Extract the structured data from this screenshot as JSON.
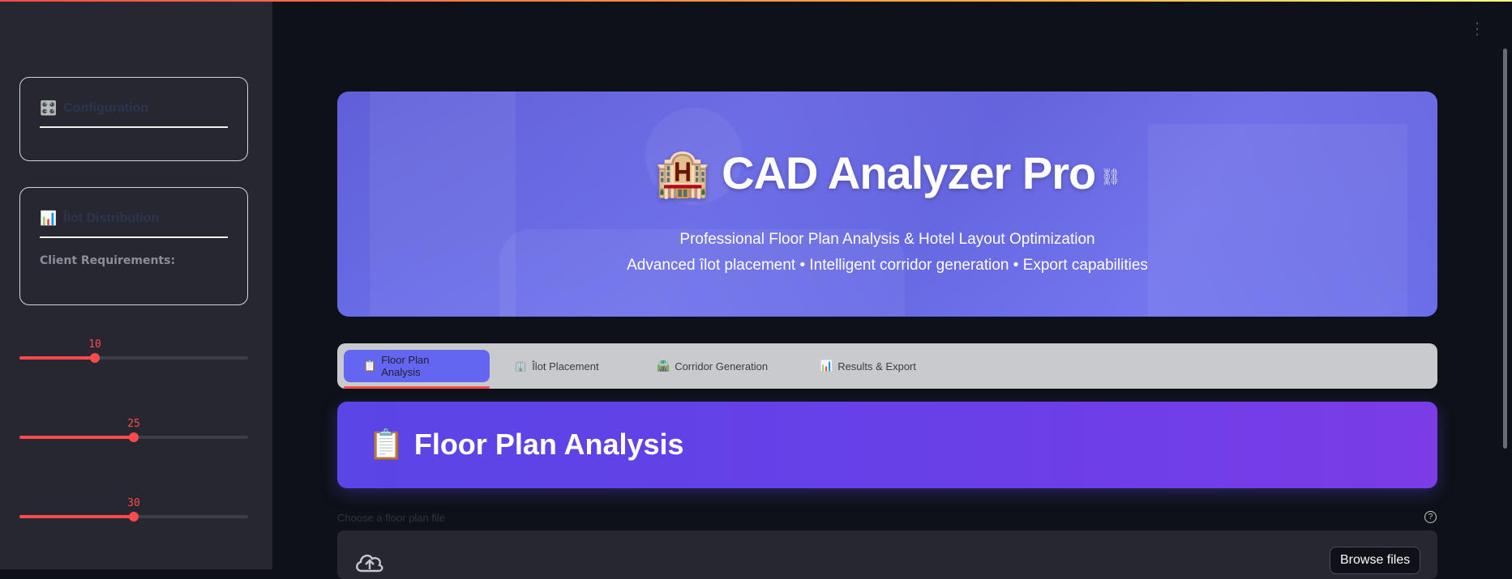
{
  "sidebar": {
    "card1": {
      "icon": "🎛️",
      "title": "Configuration",
      "icon_name": "controls-icon"
    },
    "card2": {
      "icon": "📊",
      "title": "Îlot Distribution",
      "subtitle": "Client Requirements:",
      "icon_name": "bar-chart-icon"
    },
    "sliders": [
      {
        "value": "10",
        "fraction": 0.33
      },
      {
        "value": "25",
        "fraction": 0.5
      },
      {
        "value": "30",
        "fraction": 0.5
      }
    ]
  },
  "hero": {
    "emoji": "🏨",
    "title": "CAD Analyzer Pro",
    "link_glyph": "⛓",
    "subtitle1": "Professional Floor Plan Analysis & Hotel Layout Optimization",
    "subtitle2": "Advanced îlot placement • Intelligent corridor generation • Export capabilities"
  },
  "tabs": [
    {
      "icon": "📋",
      "label": "Floor Plan Analysis"
    },
    {
      "icon": "🏢",
      "label": "Îlot Placement"
    },
    {
      "icon": "🛣️",
      "label": "Corridor Generation"
    },
    {
      "icon": "📊",
      "label": "Results & Export"
    }
  ],
  "section": {
    "icon": "📋",
    "title": "Floor Plan Analysis"
  },
  "uploader": {
    "label": "Choose a floor plan file",
    "browse_label": "Browse files",
    "help_glyph": "?"
  },
  "menu_glyph": "⋮",
  "colors": {
    "accent": "#ff4b4b",
    "tab_active": "#6366f1",
    "hero": "#5e5ce6",
    "section": "#6a3fe8"
  }
}
